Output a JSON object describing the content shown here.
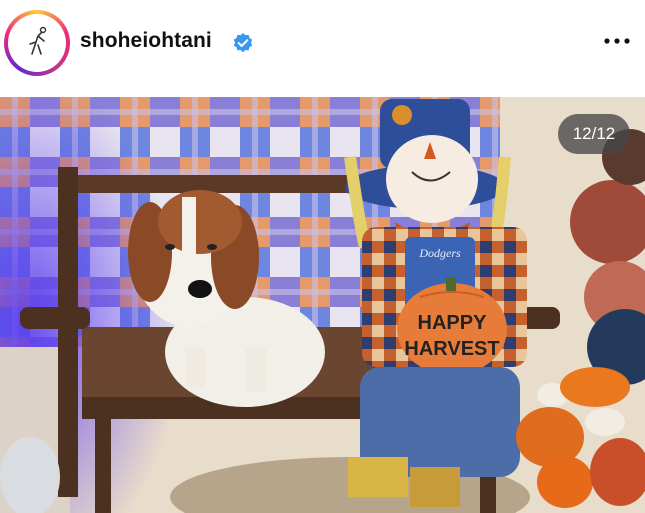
{
  "post": {
    "username": "shoheiohtani",
    "verified": true,
    "avatar_icon": "profile-avatar",
    "more_icon": "more-options-icon"
  },
  "carousel": {
    "counter": "12/12",
    "current": 12,
    "total": 12
  },
  "photo": {
    "pumpkin_text_line1": "HAPPY",
    "pumpkin_text_line2": "HARVEST",
    "shirt_text": "Dodgers"
  },
  "colors": {
    "verified_blue": "#3897f0",
    "text": "#111111"
  }
}
